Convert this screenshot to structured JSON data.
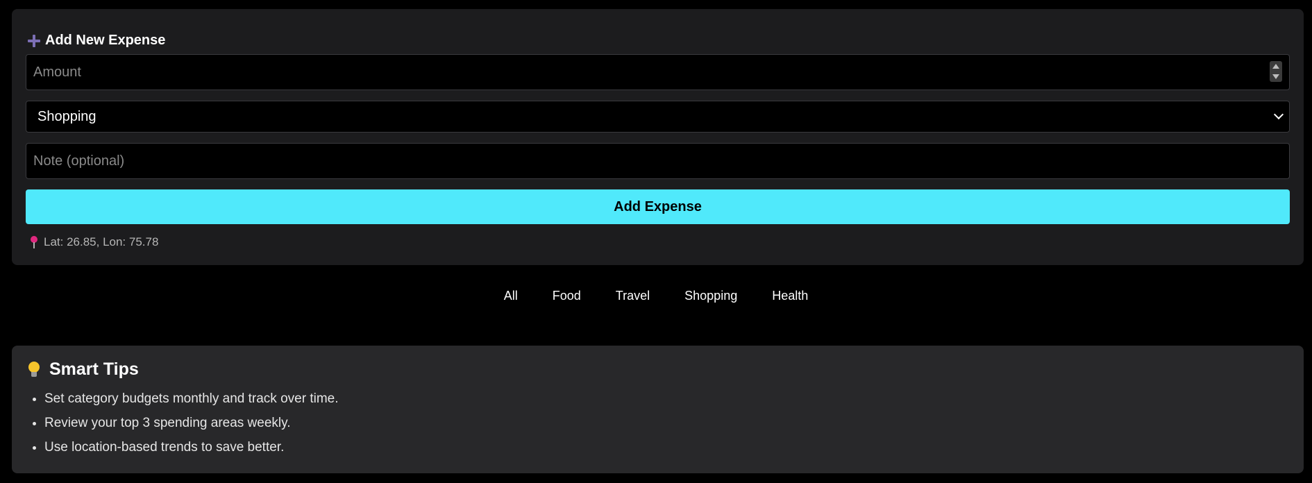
{
  "add_expense": {
    "title": "Add New Expense",
    "amount_placeholder": "Amount",
    "category_selected": "Shopping",
    "note_placeholder": "Note (optional)",
    "button_label": "Add Expense",
    "location_text": "Lat: 26.85, Lon: 75.78"
  },
  "filters": [
    "All",
    "Food",
    "Travel",
    "Shopping",
    "Health"
  ],
  "tips": {
    "title": "Smart Tips",
    "items": [
      "Set category budgets monthly and track over time.",
      "Review your top 3 spending areas weekly.",
      "Use location-based trends to save better."
    ]
  },
  "colors": {
    "background": "#000000",
    "card": "#1c1c1e",
    "tips_card": "#28282a",
    "accent_button": "#50e9fb",
    "plus_icon": "#7c6fb5",
    "pin_icon": "#e0287f"
  },
  "icons": {
    "title_icon": "plus-icon",
    "location_icon": "pin-icon",
    "tips_icon": "lightbulb-icon"
  }
}
